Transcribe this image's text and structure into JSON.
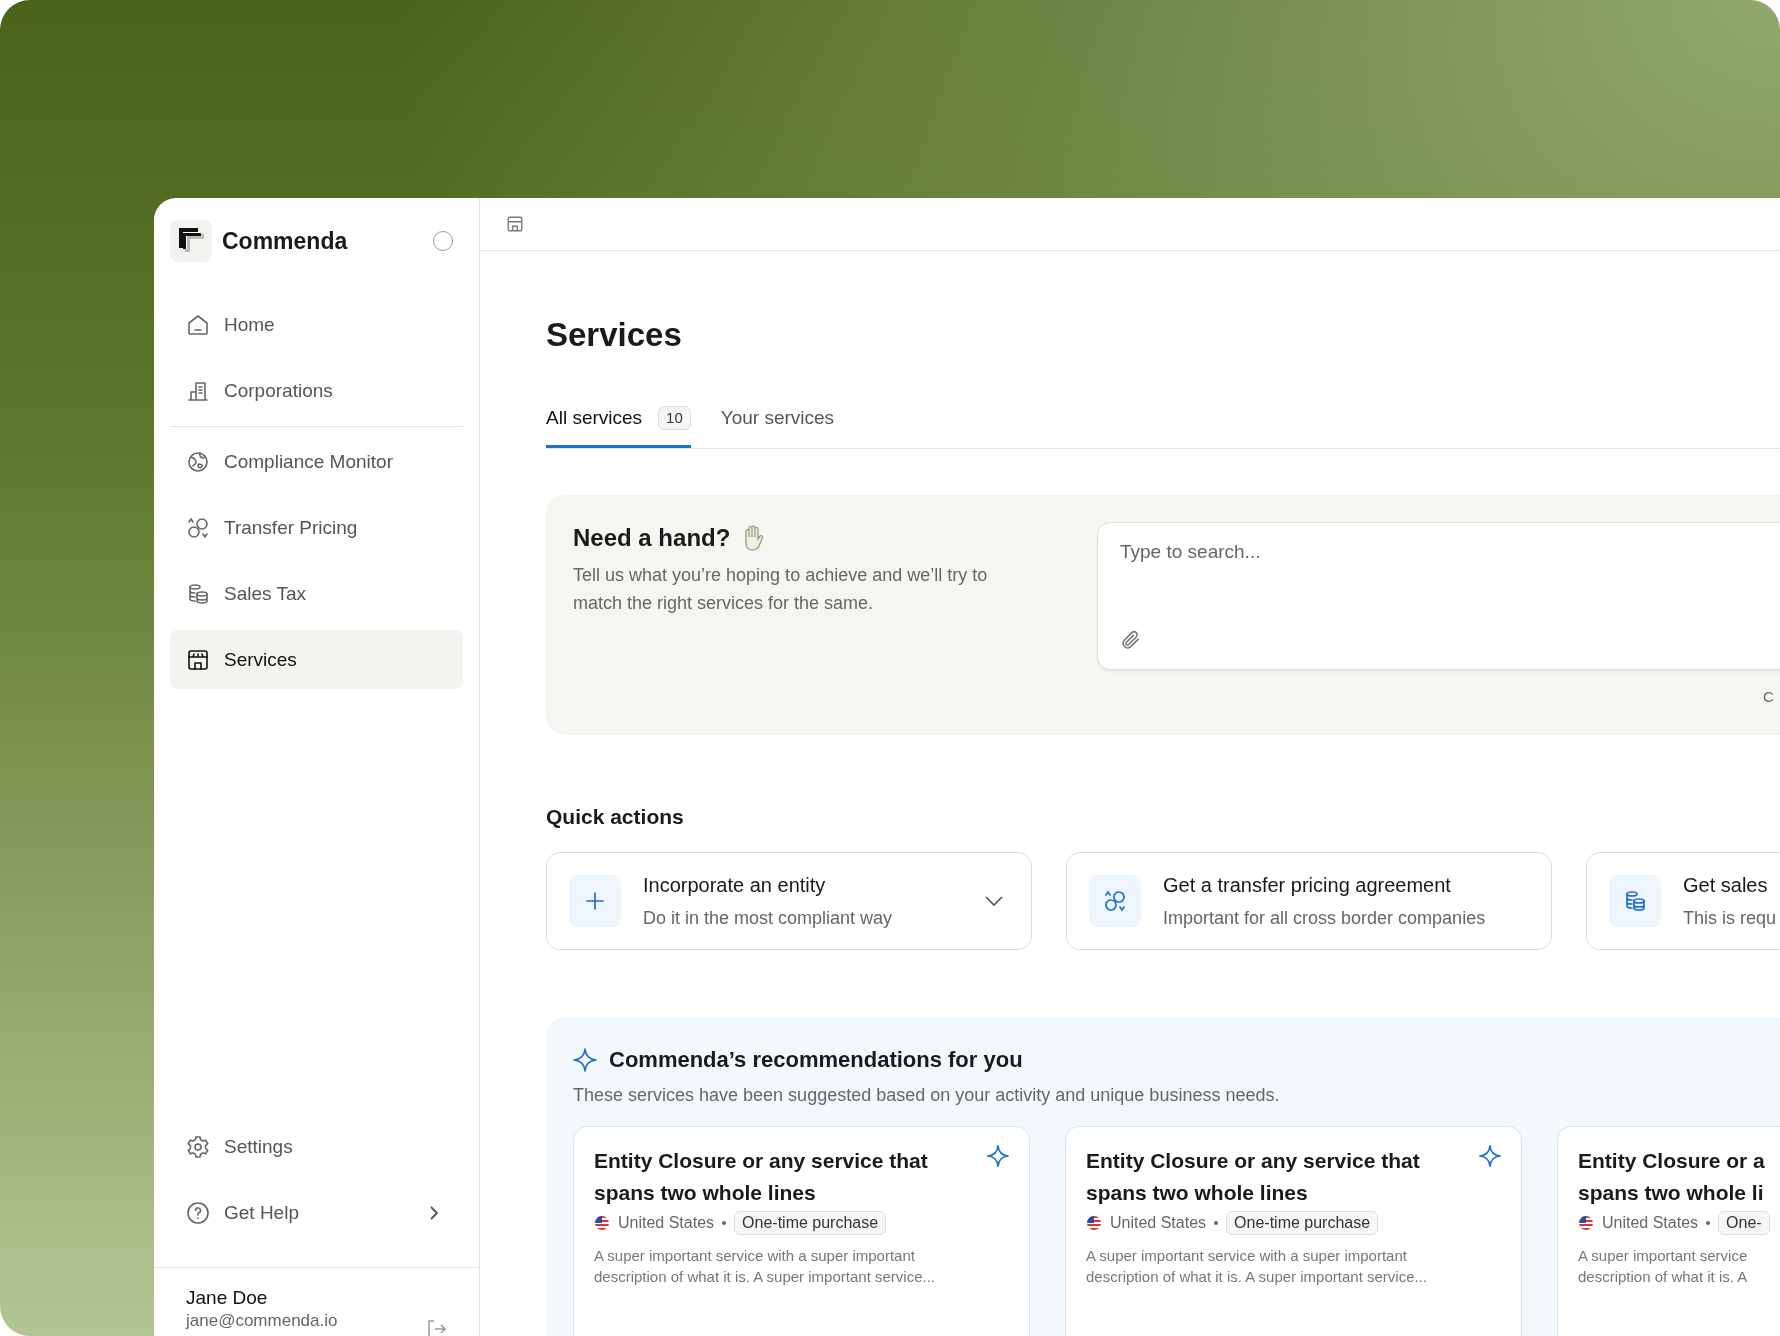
{
  "brand": {
    "name": "Commenda"
  },
  "nav_groups": [
    {
      "items": [
        {
          "label": "Home",
          "selected": false
        },
        {
          "label": "Corporations",
          "selected": false
        }
      ]
    },
    {
      "items": [
        {
          "label": "Compliance Monitor",
          "selected": false
        },
        {
          "label": "Transfer Pricing",
          "selected": false
        },
        {
          "label": "Sales Tax",
          "selected": false
        },
        {
          "label": "Services",
          "selected": true
        }
      ]
    }
  ],
  "nav_footer": [
    {
      "label": "Settings",
      "kind": "link"
    },
    {
      "label": "Get Help",
      "kind": "submenu"
    }
  ],
  "user": {
    "name": "Jane Doe",
    "email": "jane@commenda.io"
  },
  "page": {
    "title": "Services"
  },
  "tabs": [
    {
      "label": "All services",
      "count": "10",
      "selected": true
    },
    {
      "label": "Your services",
      "selected": false
    }
  ],
  "help_panel": {
    "title": "Need a hand?",
    "text": "Tell us what you’re hoping to achieve and we’ll try to match the right services for the same.",
    "search": {
      "placeholder": "Type to search..."
    },
    "hint": "C"
  },
  "quick_actions": {
    "title": "Quick actions",
    "items": [
      {
        "title": "Incorporate an entity",
        "subtitle": "Do it in the most compliant way",
        "expandable": true
      },
      {
        "title": "Get a transfer pricing agreement",
        "subtitle": "Important for all cross border companies",
        "expandable": false
      },
      {
        "title": "Get sales",
        "subtitle": "This is requ"
      }
    ]
  },
  "recommendations": {
    "title": "Commenda’s recommendations for you",
    "subtitle": "These services have been suggested based on your activity and unique business needs.",
    "cards": [
      {
        "title_lines": [
          "Entity Closure or any service that",
          "spans two whole lines"
        ],
        "country": "United States",
        "tag": "One-time purchase",
        "description_lines": [
          "A super important service with a super important",
          "description of what it is. A super important service..."
        ],
        "starred": true
      },
      {
        "title_lines": [
          "Entity Closure or any service that",
          "spans two whole lines"
        ],
        "country": "United States",
        "tag": "One-time purchase",
        "description_lines": [
          "A super important service with a super important",
          "description of what it is. A super important service..."
        ],
        "starred": true
      },
      {
        "title_lines": [
          "Entity Closure or a",
          "spans two whole li"
        ],
        "country": "United States",
        "tag": "One-",
        "description_lines": [
          "A super important service",
          "description of what it is. A"
        ]
      }
    ]
  }
}
